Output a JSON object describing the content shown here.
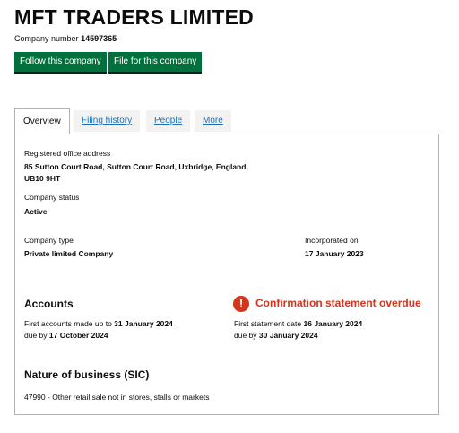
{
  "company": {
    "name": "MFT TRADERS LIMITED",
    "number_label": "Company number",
    "number": "14597365"
  },
  "actions": {
    "follow_label": "Follow this company",
    "file_label": "File for this company"
  },
  "tabs": [
    {
      "label": "Overview",
      "active": true
    },
    {
      "label": "Filing history",
      "active": false
    },
    {
      "label": "People",
      "active": false
    },
    {
      "label": "More",
      "active": false
    }
  ],
  "overview": {
    "address_label": "Registered office address",
    "address_line1": "85 Sutton Court Road, Sutton Court Road, Uxbridge, England,",
    "address_line2": "UB10 9HT",
    "status_label": "Company status",
    "status": "Active",
    "type_label": "Company type",
    "type": "Private limited Company",
    "incorporated_label": "Incorporated on",
    "incorporated": "17 January 2023"
  },
  "accounts": {
    "heading": "Accounts",
    "made_up_prefix": "First accounts made up to",
    "made_up_date": "31 January 2024",
    "due_prefix": "due by",
    "due_date": "17 October 2024"
  },
  "confirmation": {
    "icon": "!",
    "heading": "Confirmation statement overdue",
    "date_prefix": "First statement date",
    "date": "16 January 2024",
    "due_prefix": "due by",
    "due_date": "30 January 2024"
  },
  "nature": {
    "heading": "Nature of business (SIC)",
    "item": "47990 - Other retail sale not in stores, stalls or markets"
  },
  "colors": {
    "button": "#00703c",
    "warning": "#d4351c",
    "link": "#1d70b8"
  }
}
